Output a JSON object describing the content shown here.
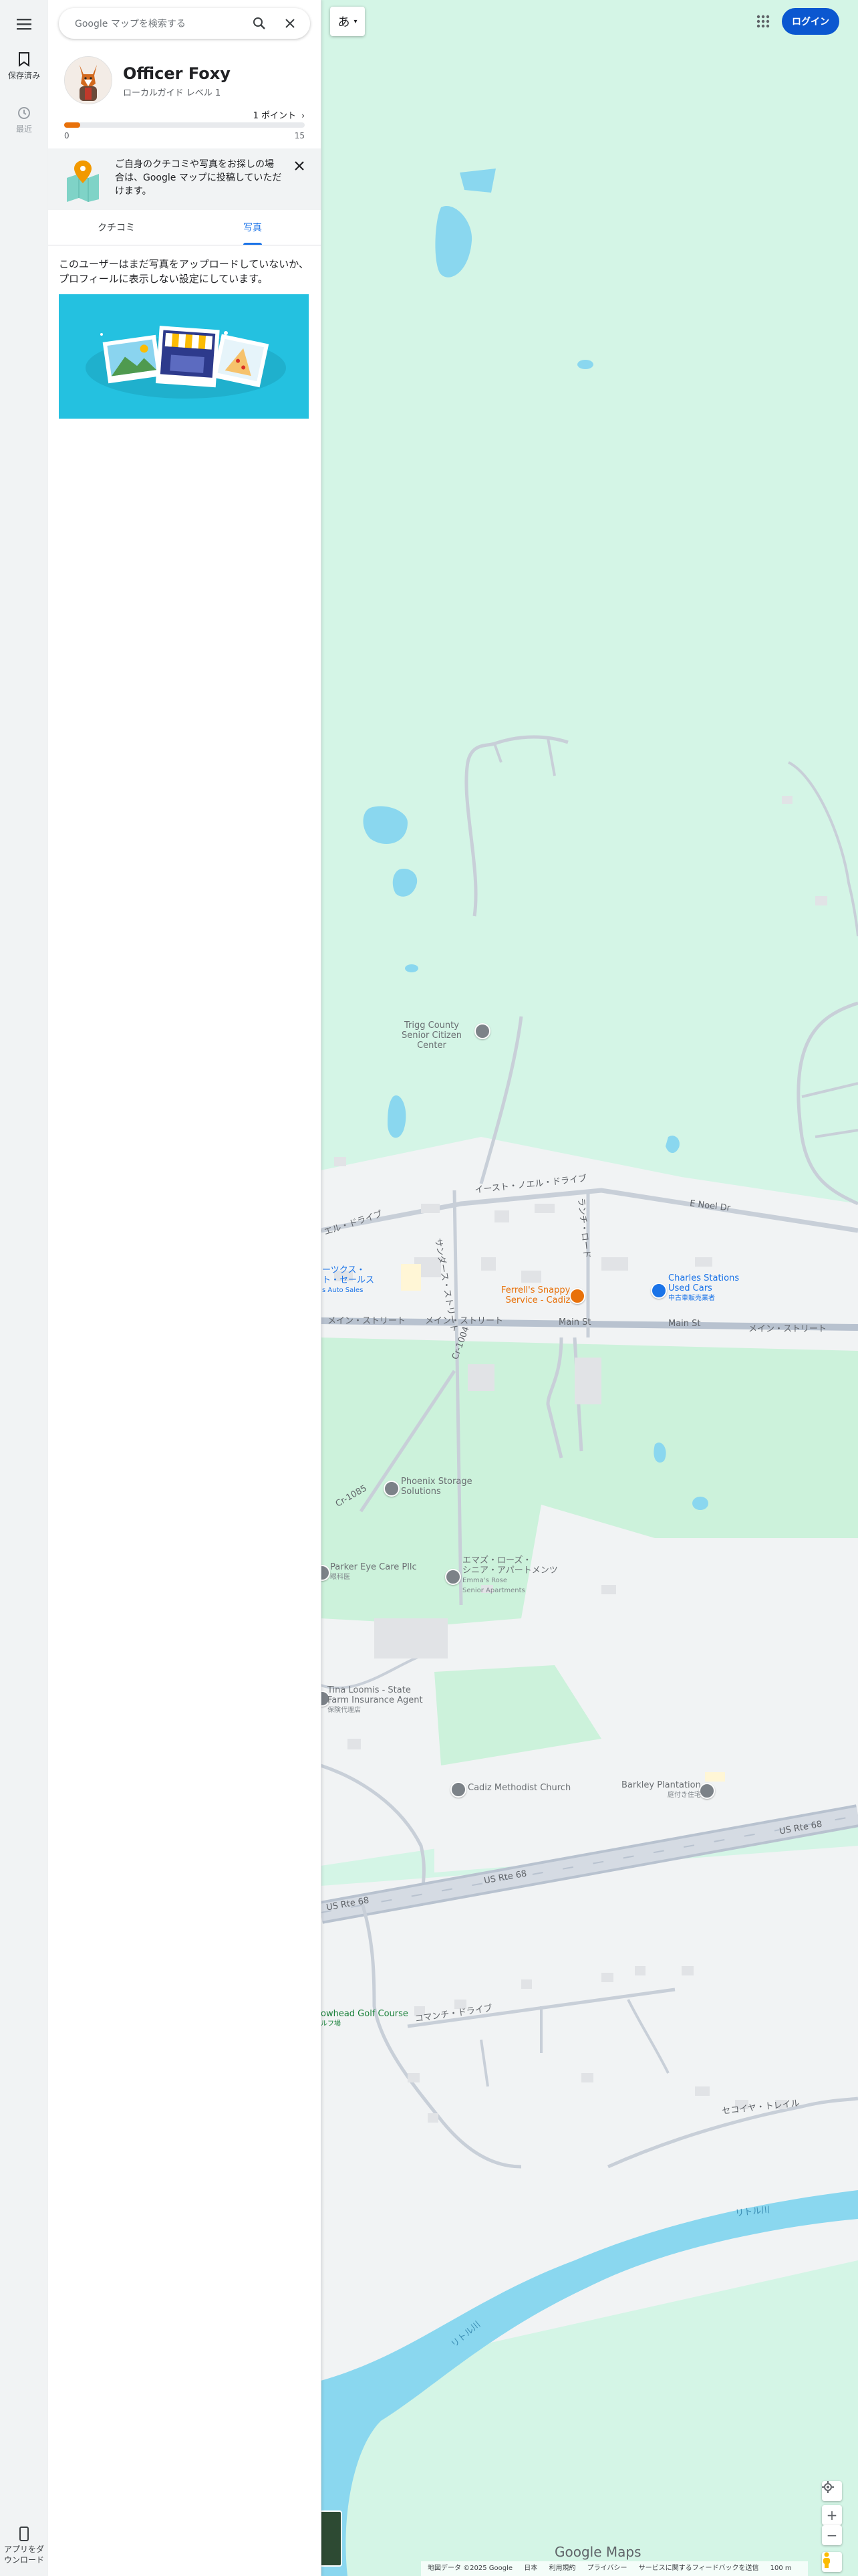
{
  "rail": {
    "saved_label": "保存済み",
    "recent_label": "最近",
    "download_label": "アプリをダウンロード"
  },
  "search": {
    "placeholder": "Google マップを検索する"
  },
  "profile": {
    "name": "Officer Foxy",
    "level": "ローカルガイド レベル 1",
    "points": "1 ポイント",
    "progress_min": "0",
    "progress_max": "15",
    "progress_fraction": 0.067
  },
  "promo": {
    "text": "ご自身のクチコミや写真をお探しの場合は、Google マップに投稿していただけます。"
  },
  "tabs": [
    {
      "label": "クチコミ",
      "active": false
    },
    {
      "label": "写真",
      "active": true
    }
  ],
  "photos_message": "このユーザーはまだ写真をアップロードしていないか、プロフィールに表示しない設定にしています。",
  "map": {
    "lang_button": "あ",
    "login_label": "ログイン",
    "logo": "Google Maps",
    "footer": [
      "地図データ ©2025 Google",
      "日本",
      "利用規約",
      "プライバシー",
      "サービスに関するフィードバックを送信",
      "100 m"
    ],
    "roads": {
      "east_noel_jp": "イースト・ノエル・ドライブ",
      "e_noel_dr": "E Noel Dr",
      "main_st": "Main St",
      "main_jp_1": "メイン・ストリート",
      "main_jp_2": "メイン・ストリート",
      "main_jp_3": "メイン・ストリート",
      "cr_1004": "Cr-1004",
      "cr_1085": "Cr-1085",
      "us_rte_68_a": "US Rte 68",
      "us_rte_68_b": "US Rte 68",
      "us_rte_68_c": "US Rte 68",
      "little_river_1": "リトル川",
      "little_river_2": "リトル川",
      "comanche": "コマンチ・ドライブ",
      "sekoiya": "セコイヤ・トレイル",
      "ranch": "ランチ・ロード",
      "noel_drive_left": "ノエル・ドライブ",
      "saunders": "サンダース・ストリート"
    },
    "pois": {
      "trigg": "Trigg County Senior Citizen Center",
      "charles_1": "Charles Stations",
      "charles_2": "Used Cars",
      "charles_sub": "中古車販売業者",
      "ferrell_1": "Ferrell's Snappy",
      "ferrell_2": "Service - Cadiz",
      "phoenix_1": "Phoenix Storage",
      "phoenix_2": "Solutions",
      "parker": "Parker Eye Care Pllc",
      "parker_sub": "眼科医",
      "emmas_jp_1": "エマズ・ローズ・",
      "emmas_jp_2": "シニア・アパートメンツ",
      "emmas_en_1": "Emma's Rose",
      "emmas_en_2": "Senior Apartments",
      "tina_1": "Tina Loomis - State",
      "tina_2": "Farm Insurance Agent",
      "tina_sub": "保険代理店",
      "methodist": "Cadiz Methodist Church",
      "barkley": "Barkley Plantation",
      "barkley_sub": "庭付き住宅",
      "arrowhead": "owhead Golf Course",
      "arrowhead_sub": "ルフ場",
      "auto_1": "ーツクス・",
      "auto_2": "ト・セールス",
      "auto_3": "s Auto Sales"
    }
  }
}
